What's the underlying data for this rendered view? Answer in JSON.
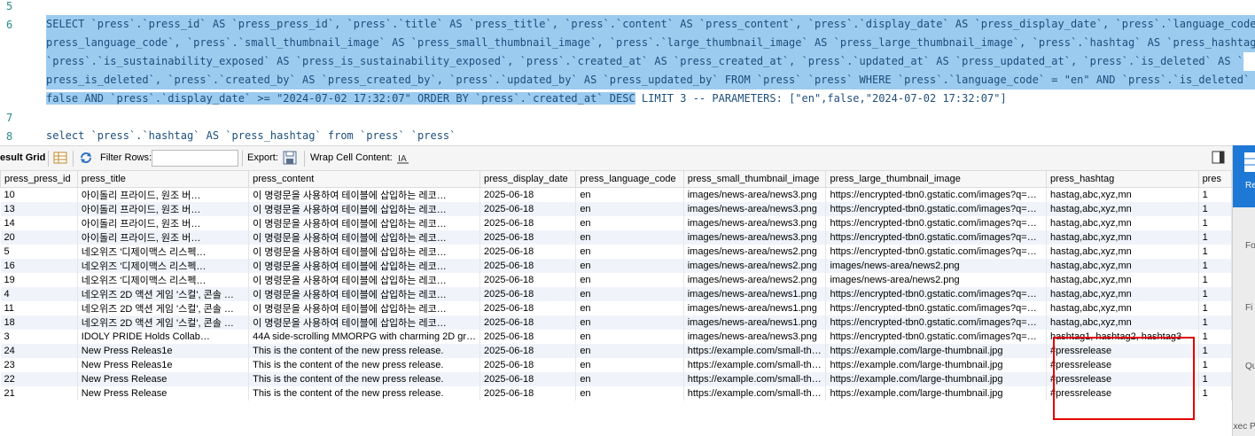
{
  "editor": {
    "line_numbers": [
      "5",
      "6",
      "7",
      "8"
    ],
    "line6": {
      "l1": "SELECT `press`.`press_id` AS `press_press_id`, `press`.`title` AS `press_title`, `press`.`content` AS `press_content`, `press`.`display_date` AS `press_display_date`, `press`.`language_code` AS `",
      "l2": "press_language_code`, `press`.`small_thumbnail_image` AS `press_small_thumbnail_image`, `press`.`large_thumbnail_image` AS `press_large_thumbnail_image`, `press`.`hashtag` AS `press_hashtag`,",
      "l3": "`press`.`is_sustainability_exposed` AS `press_is_sustainability_exposed`, `press`.`created_at` AS `press_created_at`, `press`.`updated_at` AS `press_updated_at`, `press`.`is_deleted` AS `",
      "l4": "press_is_deleted`, `press`.`created_by` AS `press_created_by`, `press`.`updated_by` AS `press_updated_by` FROM `press` `press` WHERE `press`.`language_code` = \"en\" AND `press`.`is_deleted` =",
      "l5_selected": "false AND `press`.`display_date` >= \"2024-07-02 17:32:07\" ORDER BY `press`.`created_at` DESC",
      "l5_rest": " LIMIT 3 -- PARAMETERS: [\"en\",false,\"2024-07-02 17:32:07\"]"
    },
    "line8": "select `press`.`hashtag` AS `press_hashtag` from `press` `press`"
  },
  "toolbar": {
    "result_grid": "esult Grid",
    "filter_rows": "Filter Rows:",
    "filter_value": "",
    "export": "Export:",
    "wrap_cell": "Wrap Cell Content:"
  },
  "grid": {
    "columns": [
      "press_press_id",
      "press_title",
      "press_content",
      "press_display_date",
      "press_language_code",
      "press_small_thumbnail_image",
      "press_large_thumbnail_image",
      "press_hashtag",
      "pres"
    ],
    "rows": [
      [
        "10",
        "아이돌리 프라이드, 원조 버…",
        "이 명령문을 사용하여 테이블에 삽입하는 레코…",
        "2025-06-18",
        "en",
        "images/news-area/news3.png",
        "https://encrypted-tbn0.gstatic.com/images?q=…",
        "hastag,abc,xyz,mn",
        "1"
      ],
      [
        "13",
        "아이돌리 프라이드, 원조 버…",
        "이 명령문을 사용하여 테이블에 삽입하는 레코…",
        "2025-06-18",
        "en",
        "images/news-area/news3.png",
        "https://encrypted-tbn0.gstatic.com/images?q=…",
        "hastag,abc,xyz,mn",
        "1"
      ],
      [
        "14",
        "아이돌리 프라이드, 원조 버…",
        "이 명령문을 사용하여 테이블에 삽입하는 레코…",
        "2025-06-18",
        "en",
        "images/news-area/news3.png",
        "https://encrypted-tbn0.gstatic.com/images?q=…",
        "hastag,abc,xyz,mn",
        "1"
      ],
      [
        "20",
        "아이돌리 프라이드, 원조 버…",
        "이 명령문을 사용하여 테이블에 삽입하는 레코…",
        "2025-06-18",
        "en",
        "images/news-area/news3.png",
        "https://encrypted-tbn0.gstatic.com/images?q=…",
        "hastag,abc,xyz,mn",
        "1"
      ],
      [
        "5",
        "네오위즈 '디제이맥스 리스펙…",
        "이 명령문을 사용하여 테이블에 삽입하는 레코…",
        "2025-06-18",
        "en",
        "images/news-area/news2.png",
        "https://encrypted-tbn0.gstatic.com/images?q=…",
        "hastag,abc,xyz,mn",
        "1"
      ],
      [
        "16",
        "네오위즈 '디제이맥스 리스펙…",
        "이 명령문을 사용하여 테이블에 삽입하는 레코…",
        "2025-06-18",
        "en",
        "images/news-area/news2.png",
        "images/news-area/news2.png",
        "hastag,abc,xyz,mn",
        "1"
      ],
      [
        "19",
        "네오위즈 '디제이맥스 리스펙…",
        "이 명령문을 사용하여 테이블에 삽입하는 레코…",
        "2025-06-18",
        "en",
        "images/news-area/news2.png",
        "images/news-area/news2.png",
        "hastag,abc,xyz,mn",
        "1"
      ],
      [
        "4",
        "네오위즈 2D 액션 게임 '스컬', 콘솔 …",
        "이 명령문을 사용하여 테이블에 삽입하는 레코…",
        "2025-06-18",
        "en",
        "images/news-area/news1.png",
        "https://encrypted-tbn0.gstatic.com/images?q=…",
        "hastag,abc,xyz,mn",
        "1"
      ],
      [
        "11",
        "네오위즈 2D 액션 게임 '스컬', 콘솔 …",
        "이 명령문을 사용하여 테이블에 삽입하는 레코…",
        "2025-06-18",
        "en",
        "images/news-area/news1.png",
        "https://encrypted-tbn0.gstatic.com/images?q=…",
        "hastag,abc,xyz,mn",
        "1"
      ],
      [
        "18",
        "네오위즈 2D 액션 게임 '스컬', 콘솔 …",
        "이 명령문을 사용하여 테이블에 삽입하는 레코…",
        "2025-06-18",
        "en",
        "images/news-area/news1.png",
        "https://encrypted-tbn0.gstatic.com/images?q=…",
        "hastag,abc,xyz,mn",
        "1"
      ],
      [
        "3",
        "IDOLY PRIDE Holds Collab…",
        "44A side-scrolling MMORPG with charming 2D gr…",
        "2025-06-18",
        "en",
        "images/news-area/news3.png",
        "https://encrypted-tbn0.gstatic.com/images?q=…",
        "hashtag1, hashtag2, hashtag3",
        "1"
      ],
      [
        "24",
        "New Press Releas1e",
        "This is the content of the new press release.",
        "2025-06-18",
        "en",
        "https://example.com/small-th…",
        "https://example.com/large-thumbnail.jpg",
        "#pressrelease",
        "1"
      ],
      [
        "23",
        "New Press Releas1e",
        "This is the content of the new press release.",
        "2025-06-18",
        "en",
        "https://example.com/small-th…",
        "https://example.com/large-thumbnail.jpg",
        "#pressrelease",
        "1"
      ],
      [
        "22",
        "New Press Release",
        "This is the content of the new press release.",
        "2025-06-18",
        "en",
        "https://example.com/small-th…",
        "https://example.com/large-thumbnail.jpg",
        "#pressrelease",
        "1"
      ],
      [
        "21",
        "New Press Release",
        "This is the content of the new press release.",
        "2025-06-18",
        "en",
        "https://example.com/small-th…",
        "https://example.com/large-thumbnail.jpg",
        "#pressrelease",
        "1"
      ]
    ]
  },
  "right_panel": {
    "items": [
      "Re Gr",
      "Fo Ed",
      "Fi Ty",
      "Qu St",
      "Exec Pl"
    ]
  },
  "colors": {
    "selection": "#9ccbf0",
    "highlight_box": "#e00000",
    "active_panel": "#1e78d6"
  }
}
